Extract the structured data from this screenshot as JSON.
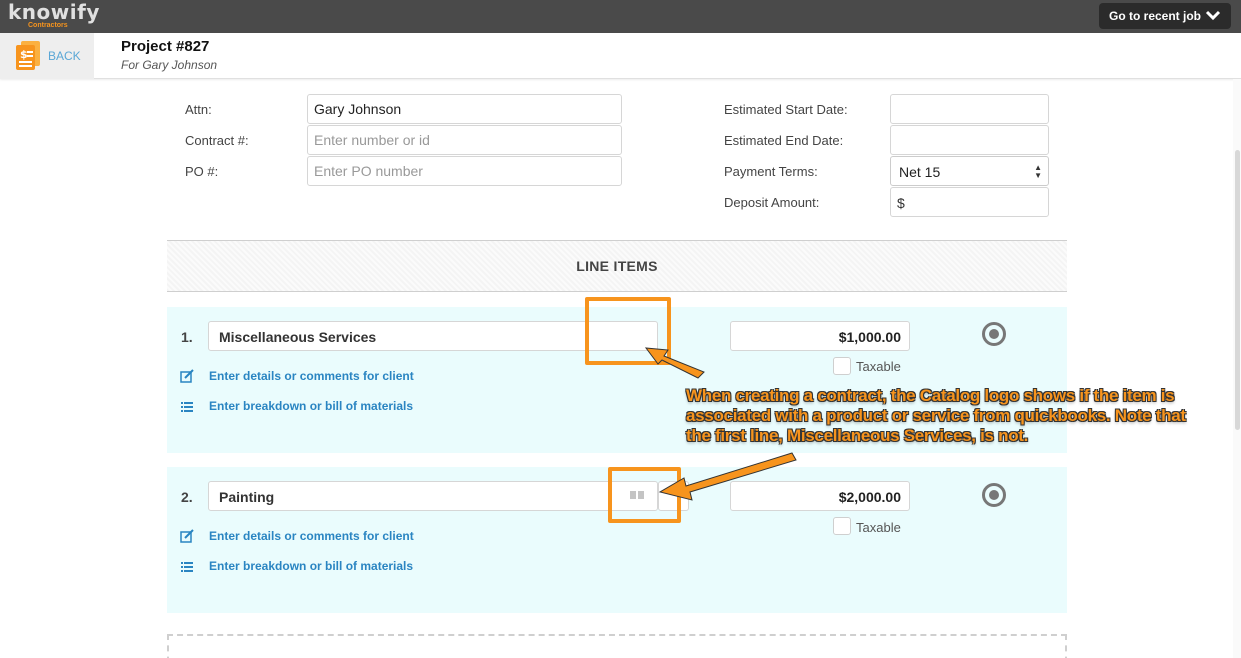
{
  "topbar": {
    "logo_text": "knowify",
    "logo_sub": "Contractors",
    "recent_job_label": "Go to recent job"
  },
  "header": {
    "back_label": "BACK",
    "project_title": "Project #827",
    "project_subtitle": "For Gary Johnson"
  },
  "form": {
    "attn_label": "Attn:",
    "attn_value": "Gary Johnson",
    "contract_label": "Contract #:",
    "contract_placeholder": "Enter number or id",
    "po_label": "PO #:",
    "po_placeholder": "Enter PO number",
    "est_start_label": "Estimated Start Date:",
    "est_end_label": "Estimated End Date:",
    "payment_terms_label": "Payment Terms:",
    "payment_terms_value": "Net 15",
    "deposit_label": "Deposit Amount:",
    "deposit_prefix": "$"
  },
  "line_items": {
    "title": "LINE ITEMS",
    "rows": [
      {
        "number": "1.",
        "name": "Miscellaneous Services",
        "price": "$1,000.00",
        "taxable_label": "Taxable",
        "details_link": "Enter details or comments for client",
        "breakdown_link": "Enter breakdown or bill of materials"
      },
      {
        "number": "2.",
        "name": "Painting",
        "price": "$2,000.00",
        "taxable_label": "Taxable",
        "details_link": "Enter details or comments for client",
        "breakdown_link": "Enter breakdown or bill of materials"
      }
    ]
  },
  "annotation": {
    "text": "When creating a contract, the Catalog logo shows if the item is associated with a product or service from quickbooks. Note that the first line, Miscellaneous Services, is not.",
    "color": "#f7941d"
  },
  "colors": {
    "topbar": "#4a4a4a",
    "accent": "#f7941d",
    "link": "#2a85c2",
    "row_bg": "#eafcfd"
  },
  "icons": [
    "chevron-down-icon",
    "document-dollar-icon",
    "edit-icon",
    "list-icon",
    "radio-selected-icon",
    "catalog-book-icon"
  ]
}
